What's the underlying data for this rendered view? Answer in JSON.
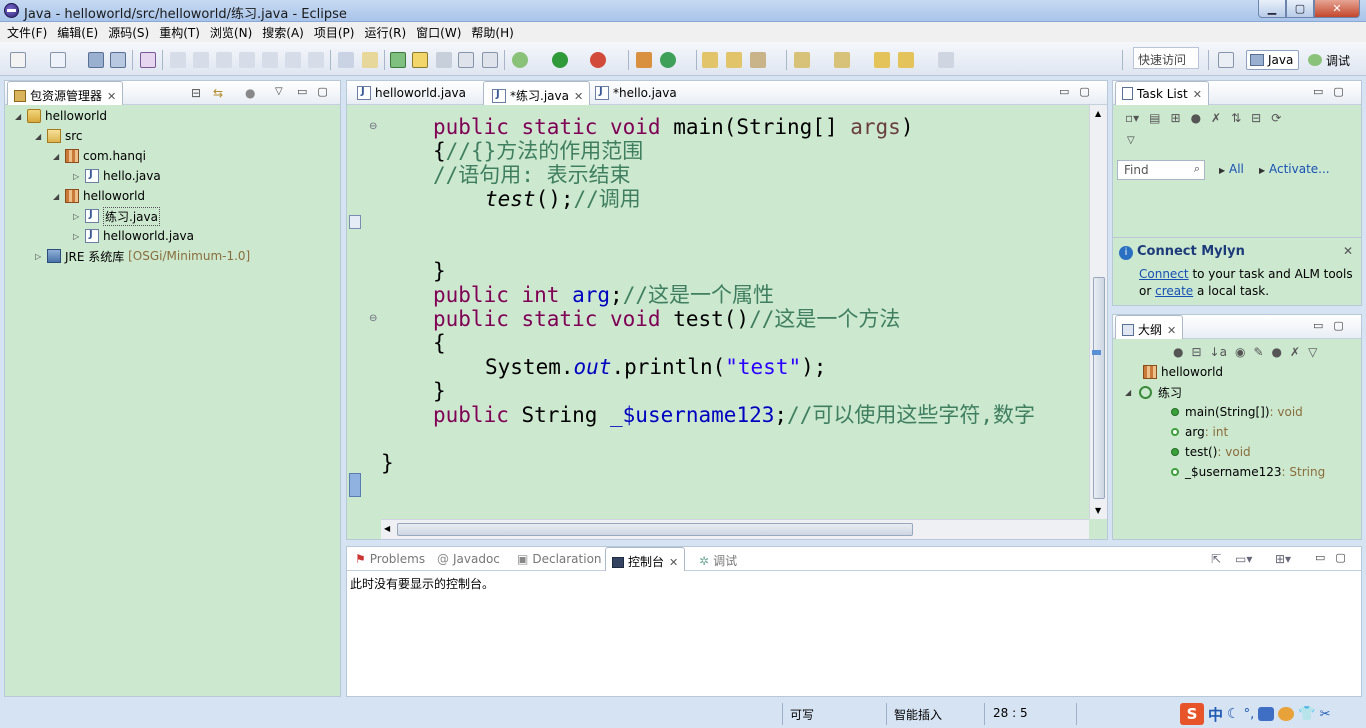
{
  "window": {
    "title": "Java - helloworld/src/helloworld/练习.java - Eclipse",
    "controls": {
      "minimize": "▁",
      "maximize": "▢",
      "close": "✕"
    }
  },
  "menu": [
    "文件(F)",
    "编辑(E)",
    "源码(S)",
    "重构(T)",
    "浏览(N)",
    "搜索(A)",
    "项目(P)",
    "运行(R)",
    "窗口(W)",
    "帮助(H)"
  ],
  "toolbar": {
    "quick_access_placeholder": "快速访问",
    "perspectives": {
      "java": "Java",
      "debug": "调试"
    }
  },
  "package_explorer": {
    "tab_label": "包资源管理器",
    "tree": {
      "project": "helloworld",
      "src": "src",
      "pkg1": "com.hanqi",
      "file1": "hello.java",
      "pkg2": "helloworld",
      "file2": "练习.java",
      "file3": "helloworld.java",
      "jre": "JRE 系统库",
      "jre_decoration": "[OSGi/Minimum-1.0]"
    }
  },
  "editor": {
    "tabs": [
      "helloworld.java",
      "*练习.java",
      "*hello.java"
    ],
    "code": {
      "l1_kw": "public static void",
      "l1_rest": " main(String[] ",
      "l1_arg": "args",
      "l1_end": ")",
      "l2_brace": "{",
      "l2_cm": "//{}方法的作用范围",
      "l3_cm": "//语句用: 表示结束",
      "l4_call": "test",
      "l4_rest": "();",
      "l4_cm": "//调用",
      "l5": "}",
      "l6_kw": "public int",
      "l6_fld": "arg",
      "l6_semi": ";",
      "l6_cm": "//这是一个属性",
      "l7_kw": "public static void",
      "l7_rest": " test()",
      "l7_cm": "//这是一个方法",
      "l8": "{",
      "l9_pre": "System.",
      "l9_out": "out",
      "l9_mid": ".println(",
      "l9_str": "\"test\"",
      "l9_end": ");",
      "l10": "}",
      "l11_kw": "public",
      "l11_rest": " String ",
      "l11_fld": "_$username123",
      "l11_semi": ";",
      "l11_cm": "//可以使用这些字符,数字",
      "l12": "}"
    }
  },
  "task_list": {
    "tab_label": "Task List",
    "find_placeholder": "Find",
    "all": "All",
    "activate": "Activate...",
    "mylyn_title": "Connect Mylyn",
    "mylyn_link1": "Connect",
    "mylyn_text1": " to your task and ALM tools",
    "mylyn_text2_pre": "or ",
    "mylyn_link2": "create",
    "mylyn_text2_post": " a local task."
  },
  "outline": {
    "tab_label": "大纲",
    "package": "helloworld",
    "class": "练习",
    "members": [
      {
        "name": "main(String[])",
        "type": " : void"
      },
      {
        "name": "arg",
        "type": " : int"
      },
      {
        "name": "test()",
        "type": " : void"
      },
      {
        "name": "_$username123",
        "type": " : String"
      }
    ]
  },
  "bottom": {
    "tabs": [
      "Problems",
      "Javadoc",
      "Declaration",
      "控制台",
      "调试"
    ],
    "console_message": "此时没有要显示的控制台。"
  },
  "status": {
    "writable": "可写",
    "insert_mode": "智能插入",
    "position": "28 : 5"
  },
  "ime": {
    "logo": "S",
    "mode": "中"
  },
  "colors": {
    "editor_bg": "#cce8cf",
    "keyword": "#7f0055",
    "comment": "#3f7f5f",
    "field": "#0000c0",
    "string": "#2a00ff"
  }
}
